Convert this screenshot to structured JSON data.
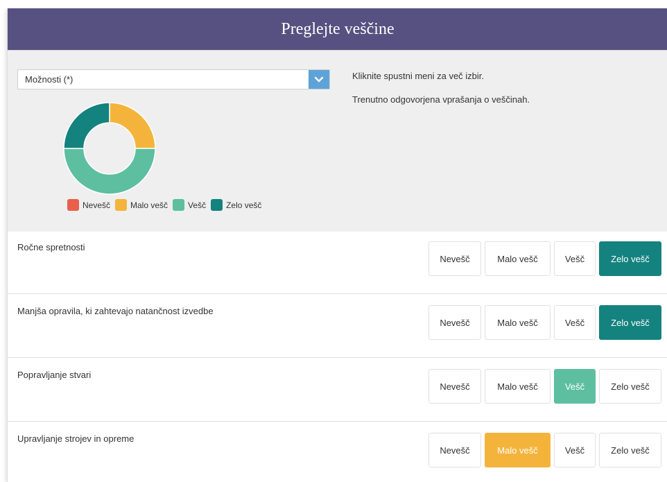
{
  "header": {
    "title": "Preglejte veščine"
  },
  "filter": {
    "selected": "Možnosti (*)",
    "dropdown_icon": "chevron-down-icon"
  },
  "info": {
    "line1": "Kliknite spustni meni za več izbir.",
    "line2": "Trenutno odgovorjena vprašanja o veščinah."
  },
  "chart_data": {
    "type": "pie",
    "variant": "donut",
    "categories": [
      "Nevešč",
      "Malo vešč",
      "Vešč",
      "Zelo vešč"
    ],
    "values": [
      0,
      1,
      2,
      1
    ],
    "colors": [
      "#e8604c",
      "#f4b43c",
      "#5dbf9f",
      "#14827f"
    ],
    "legend": "bottom"
  },
  "levels": [
    "Nevešč",
    "Malo vešč",
    "Vešč",
    "Zelo vešč"
  ],
  "colors": {
    "header": "#565180",
    "zelo": "#14827f",
    "vesc": "#5dbf9f",
    "malo": "#f4b43c",
    "nevesc": "#e8604c",
    "select_button": "#5ea3d8"
  },
  "skills": [
    {
      "name": "Ročne spretnosti",
      "selected": "Zelo vešč"
    },
    {
      "name": "Manjša opravila, ki zahtevajo natančnost izvedbe",
      "selected": "Zelo vešč"
    },
    {
      "name": "Popravljanje stvari",
      "selected": "Vešč"
    },
    {
      "name": "Upravljanje strojev in opreme",
      "selected": "Malo vešč"
    }
  ]
}
